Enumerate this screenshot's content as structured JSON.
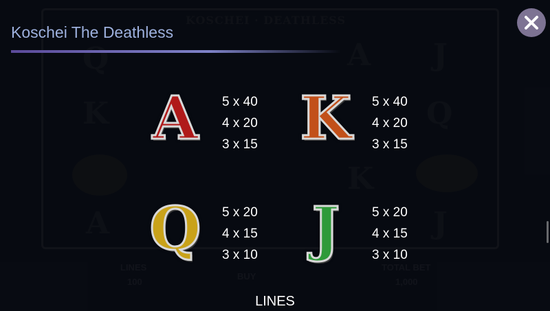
{
  "header": {
    "title": "Koschei The Deathless",
    "accent_color": "#7e82c8"
  },
  "close_button": {
    "icon": "close-icon",
    "color": "#7d7393"
  },
  "symbols": [
    {
      "glyph": "A",
      "color": "#b01a1a",
      "pays": [
        "5 x 40",
        "4 x 20",
        "3 x 15"
      ]
    },
    {
      "glyph": "K",
      "color": "#c2501a",
      "pays": [
        "5 x 40",
        "4 x 20",
        "3 x 15"
      ]
    },
    {
      "glyph": "Q",
      "color": "#c9a21a",
      "pays": [
        "5 x 20",
        "4 x 15",
        "3 x 10"
      ]
    },
    {
      "glyph": "J",
      "color": "#2f9a3a",
      "pays": [
        "5 x 20",
        "4 x 15",
        "3 x 10"
      ]
    }
  ],
  "footer": {
    "label": "LINES"
  }
}
